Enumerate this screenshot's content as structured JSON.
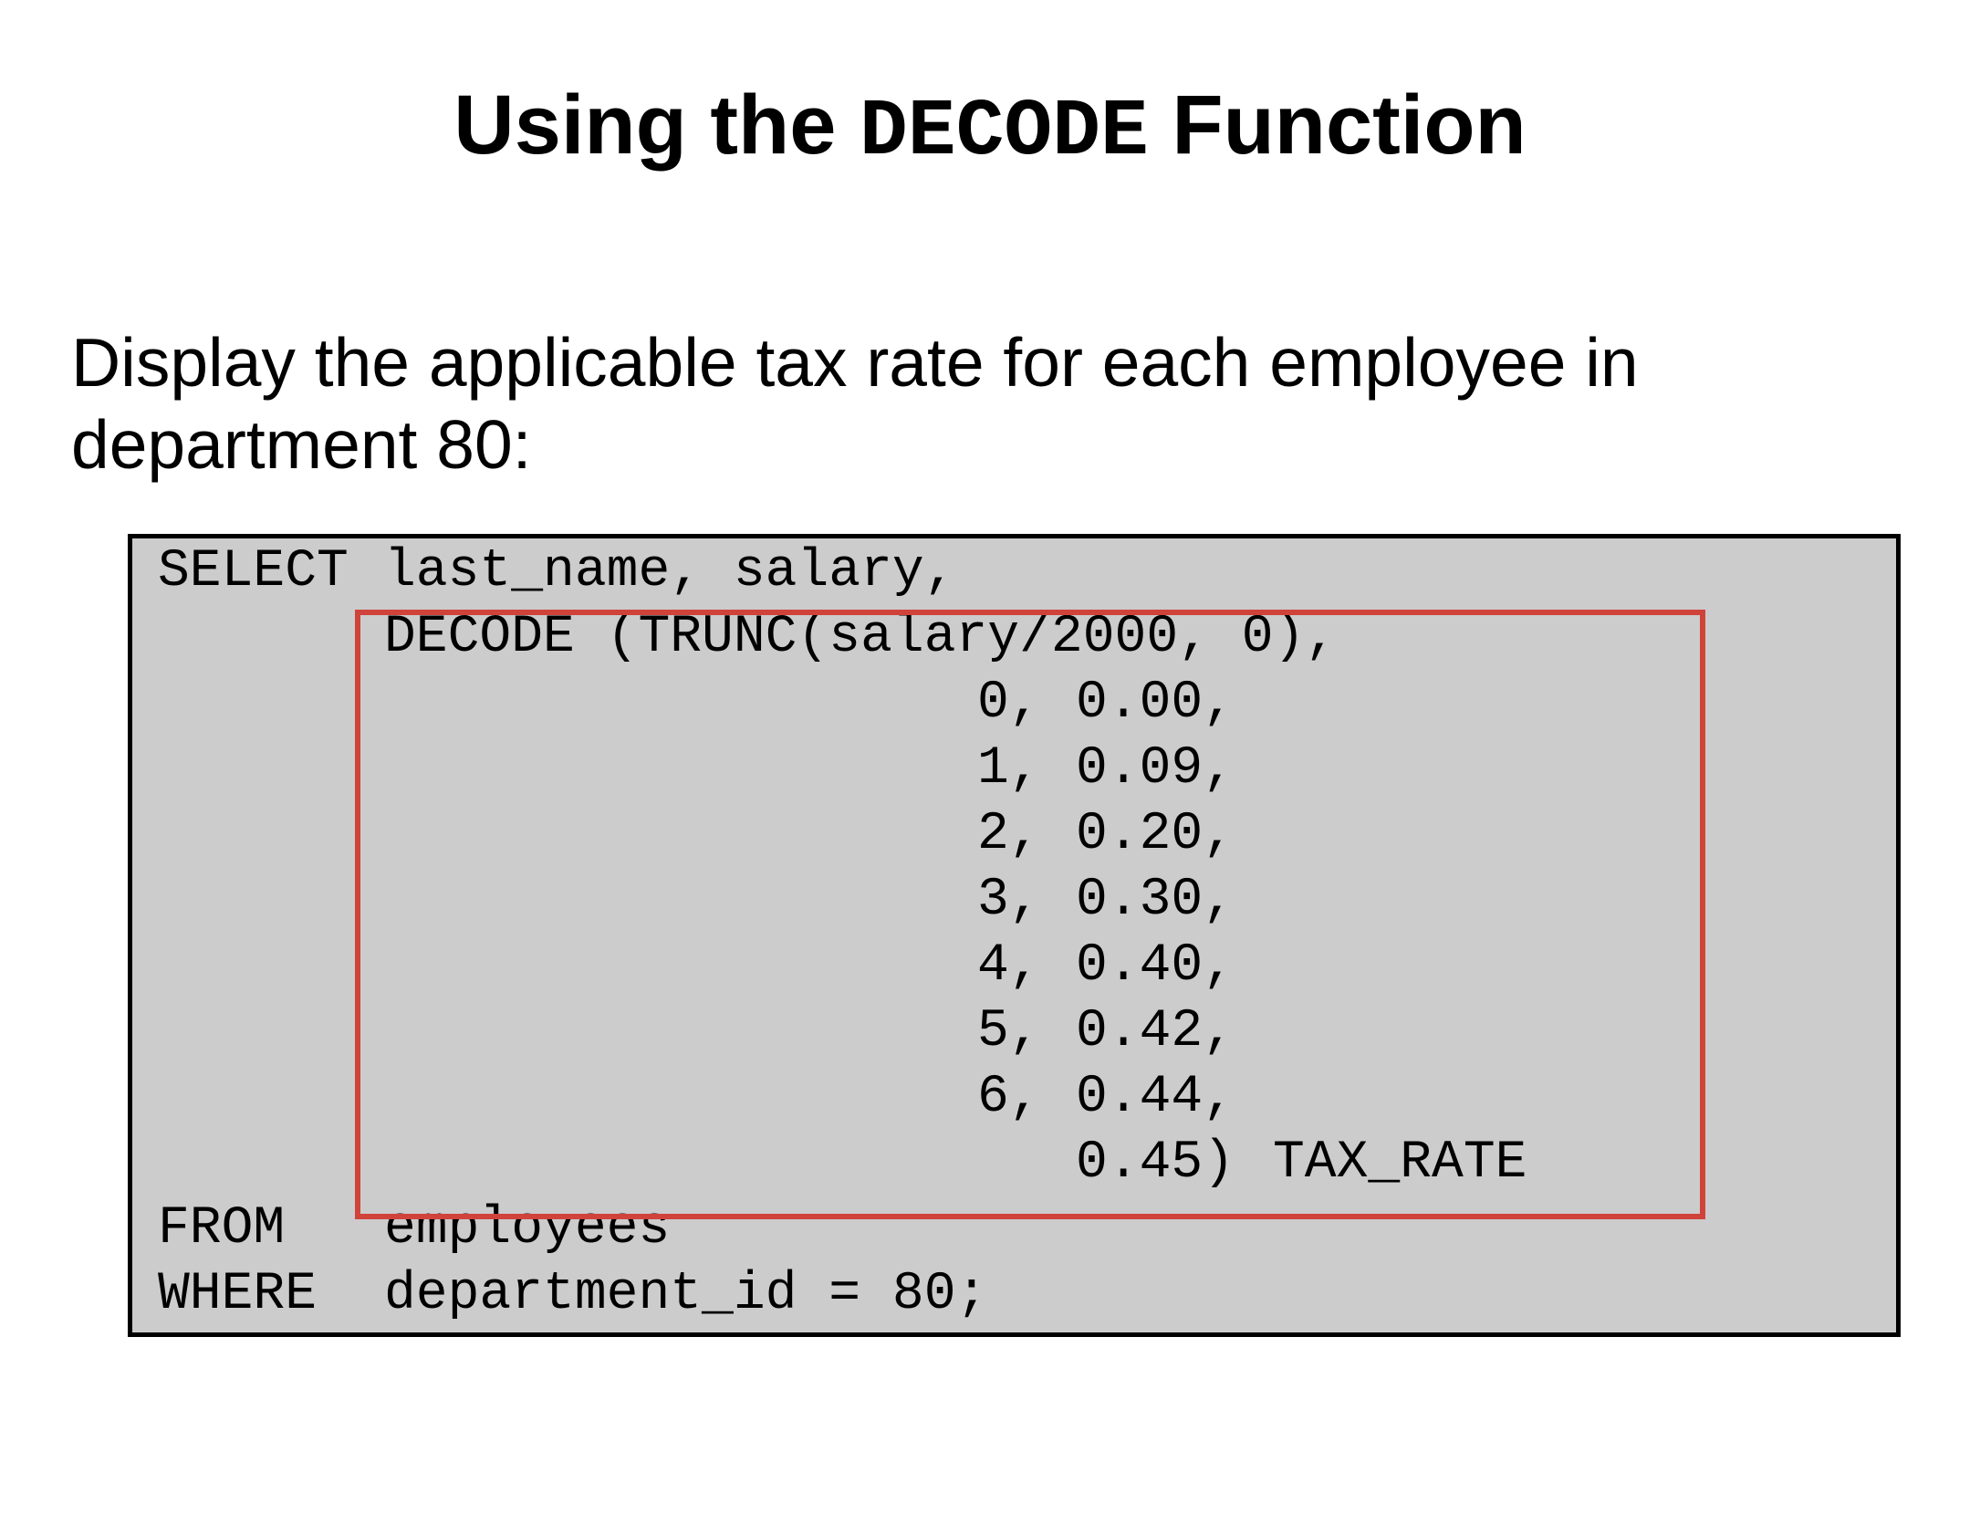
{
  "title": {
    "prefix": "Using the ",
    "keyword": "DECODE",
    "suffix": " Function"
  },
  "intro": {
    "line1": "Display the applicable tax rate for each employee in",
    "line2": "department 80:"
  },
  "code": {
    "select_keyword": "SELECT",
    "select_columns": "last_name, salary,",
    "decode_call": "DECODE (TRUNC(salary/2000, 0),",
    "pairs": [
      {
        "search": "0,",
        "result": "0.00,"
      },
      {
        "search": "1,",
        "result": "0.09,"
      },
      {
        "search": "2,",
        "result": "0.20,"
      },
      {
        "search": "3,",
        "result": "0.30,"
      },
      {
        "search": "4,",
        "result": "0.40,"
      },
      {
        "search": "5,",
        "result": "0.42,"
      },
      {
        "search": "6,",
        "result": "0.44,"
      }
    ],
    "default_value": "0.45)",
    "alias": "TAX_RATE",
    "from_keyword": "FROM",
    "from_table": "employees",
    "where_keyword": "WHERE",
    "where_condition": "department_id = 80;"
  },
  "colors": {
    "code_background": "#cccccc",
    "highlight_border": "#d0433a",
    "box_border": "#000000"
  }
}
